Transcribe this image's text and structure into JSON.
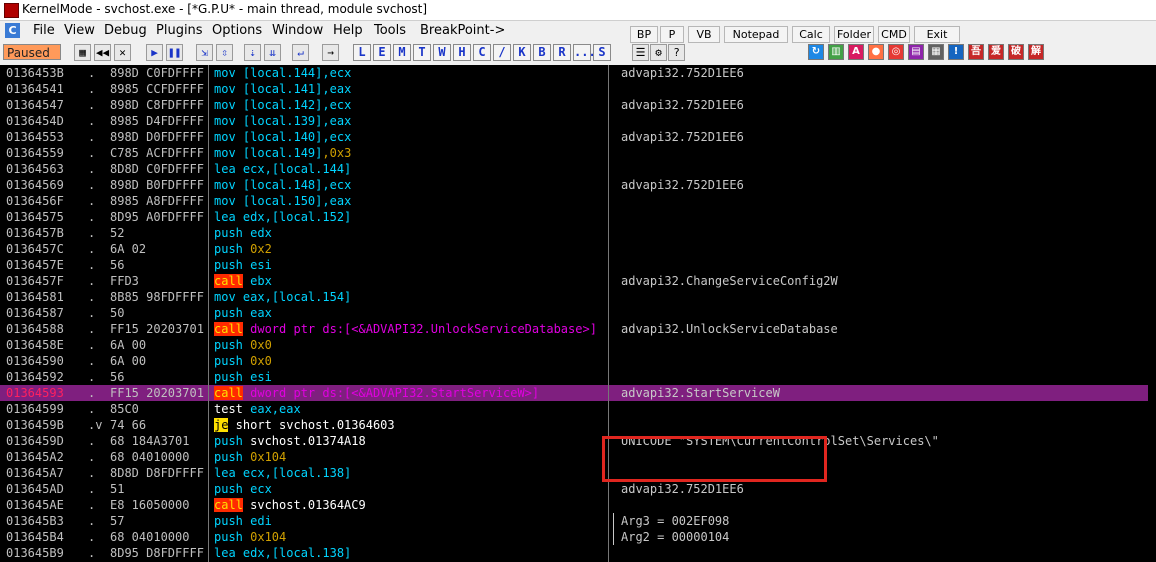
{
  "window": {
    "title": "KernelMode - svchost.exe - [*G.P.U* - main thread, module svchost]",
    "app_icon": "C"
  },
  "menu": [
    "File",
    "View",
    "Debug",
    "Plugins",
    "Options",
    "Window",
    "Help",
    "Tools",
    "BreakPoint->"
  ],
  "gpu_buttons": [
    "BP",
    "P",
    "VB",
    "Notepad",
    "Calc",
    "Folder",
    "CMD",
    "Exit"
  ],
  "toolbar": {
    "status": "Paused",
    "left_buttons": [
      "open-icon",
      "rewind-icon",
      "close-icon",
      "play-icon",
      "pause-icon",
      "step-into-icon",
      "step-over-icon",
      "trace-into-icon",
      "trace-over-icon",
      "execute-till-return-icon",
      "go-to-icon"
    ],
    "letters": [
      "L",
      "E",
      "M",
      "T",
      "W",
      "H",
      "C",
      "/",
      "K",
      "B",
      "R",
      "...",
      "S"
    ],
    "right_icons": [
      "refresh-icon",
      "plugin-icon",
      "a-icon",
      "record-icon",
      "target-icon",
      "bookmark-icon",
      "grid-icon",
      "help-icon"
    ],
    "cn_icons": [
      "吾",
      "爱",
      "破",
      "解"
    ],
    "aux_icons": [
      "list-icon",
      "settings-icon",
      "help-icon"
    ]
  },
  "rows": [
    {
      "addr": "0136453B",
      "dot": ".",
      "hex": "898D C0FDFFFF",
      "dis": [
        [
          "mov",
          "mn"
        ],
        [
          " [local.144]",
          "op-brk"
        ],
        [
          ",ecx",
          "op-brk"
        ]
      ],
      "comment": "advapi32.752D1EE6"
    },
    {
      "addr": "01364541",
      "dot": ".",
      "hex": "8985 CCFDFFFF",
      "dis": [
        [
          "mov",
          "mn"
        ],
        [
          " [local.141]",
          "op-brk"
        ],
        [
          ",eax",
          "op-brk"
        ]
      ],
      "comment": ""
    },
    {
      "addr": "01364547",
      "dot": ".",
      "hex": "898D C8FDFFFF",
      "dis": [
        [
          "mov",
          "mn"
        ],
        [
          " [local.142]",
          "op-brk"
        ],
        [
          ",ecx",
          "op-brk"
        ]
      ],
      "comment": "advapi32.752D1EE6"
    },
    {
      "addr": "0136454D",
      "dot": ".",
      "hex": "8985 D4FDFFFF",
      "dis": [
        [
          "mov",
          "mn"
        ],
        [
          " [local.139]",
          "op-brk"
        ],
        [
          ",eax",
          "op-brk"
        ]
      ],
      "comment": ""
    },
    {
      "addr": "01364553",
      "dot": ".",
      "hex": "898D D0FDFFFF",
      "dis": [
        [
          "mov",
          "mn"
        ],
        [
          " [local.140]",
          "op-brk"
        ],
        [
          ",ecx",
          "op-brk"
        ]
      ],
      "comment": "advapi32.752D1EE6"
    },
    {
      "addr": "01364559",
      "dot": ".",
      "hex": "C785 ACFDFFFF",
      "dis": [
        [
          "mov",
          "mn"
        ],
        [
          " [local.149]",
          "op-brk"
        ],
        [
          ",0x3",
          "op-const"
        ]
      ],
      "comment": ""
    },
    {
      "addr": "01364563",
      "dot": ".",
      "hex": "8D8D C0FDFFFF",
      "dis": [
        [
          "lea",
          "mn"
        ],
        [
          " ecx,",
          "op-brk"
        ],
        [
          "[local.144]",
          "op-brk"
        ]
      ],
      "comment": ""
    },
    {
      "addr": "01364569",
      "dot": ".",
      "hex": "898D B0FDFFFF",
      "dis": [
        [
          "mov",
          "mn"
        ],
        [
          " [local.148]",
          "op-brk"
        ],
        [
          ",ecx",
          "op-brk"
        ]
      ],
      "comment": "advapi32.752D1EE6"
    },
    {
      "addr": "0136456F",
      "dot": ".",
      "hex": "8985 A8FDFFFF",
      "dis": [
        [
          "mov",
          "mn"
        ],
        [
          " [local.150]",
          "op-brk"
        ],
        [
          ",eax",
          "op-brk"
        ]
      ],
      "comment": ""
    },
    {
      "addr": "01364575",
      "dot": ".",
      "hex": "8D95 A0FDFFFF",
      "dis": [
        [
          "lea",
          "mn"
        ],
        [
          " edx,",
          "op-brk"
        ],
        [
          "[local.152]",
          "op-brk"
        ]
      ],
      "comment": ""
    },
    {
      "addr": "0136457B",
      "dot": ".",
      "hex": "52",
      "dis": [
        [
          "push",
          "mn"
        ],
        [
          " edx",
          "op-brk"
        ]
      ],
      "comment": ""
    },
    {
      "addr": "0136457C",
      "dot": ".",
      "hex": "6A 02",
      "dis": [
        [
          "push",
          "mn"
        ],
        [
          " 0x2",
          "op-const"
        ]
      ],
      "comment": ""
    },
    {
      "addr": "0136457E",
      "dot": ".",
      "hex": "56",
      "dis": [
        [
          "push",
          "mn"
        ],
        [
          " esi",
          "op-brk"
        ]
      ],
      "comment": ""
    },
    {
      "addr": "0136457F",
      "dot": ".",
      "hex": "FFD3",
      "dis": [
        [
          "call",
          "call"
        ],
        [
          " ebx",
          "op-brk"
        ]
      ],
      "comment": "advapi32.ChangeServiceConfig2W"
    },
    {
      "addr": "01364581",
      "dot": ".",
      "hex": "8B85 98FDFFFF",
      "dis": [
        [
          "mov",
          "mn"
        ],
        [
          " eax,",
          "op-brk"
        ],
        [
          "[local.154]",
          "op-brk"
        ]
      ],
      "comment": ""
    },
    {
      "addr": "01364587",
      "dot": ".",
      "hex": "50",
      "dis": [
        [
          "push",
          "mn"
        ],
        [
          " eax",
          "op-brk"
        ]
      ],
      "comment": ""
    },
    {
      "addr": "01364588",
      "dot": ".",
      "hex": "FF15 20203701",
      "dis": [
        [
          "call",
          "call"
        ],
        [
          " dword ptr ds:[<&ADVAPI32.UnlockServiceDatabase>]",
          "op-ds"
        ]
      ],
      "comment": "advapi32.UnlockServiceDatabase"
    },
    {
      "addr": "0136458E",
      "dot": ".",
      "hex": "6A 00",
      "dis": [
        [
          "push",
          "mn"
        ],
        [
          " 0x0",
          "op-const"
        ]
      ],
      "comment": ""
    },
    {
      "addr": "01364590",
      "dot": ".",
      "hex": "6A 00",
      "dis": [
        [
          "push",
          "mn"
        ],
        [
          " 0x0",
          "op-const"
        ]
      ],
      "comment": ""
    },
    {
      "addr": "01364592",
      "dot": ".",
      "hex": "56",
      "dis": [
        [
          "push",
          "mn"
        ],
        [
          " esi",
          "op-brk"
        ]
      ],
      "comment": ""
    },
    {
      "addr": "01364593",
      "dot": ".",
      "hex": "FF15 20203701",
      "dis": [
        [
          "call",
          "call"
        ],
        [
          " dword ptr ds:[<&ADVAPI32.StartServiceW>]",
          "op-ds"
        ]
      ],
      "comment": "advapi32.StartServiceW",
      "selected": true
    },
    {
      "addr": "01364599",
      "dot": ".",
      "hex": "85C0",
      "dis": [
        [
          "test",
          "test"
        ],
        [
          " eax,eax",
          "op-brk"
        ]
      ],
      "comment": ""
    },
    {
      "addr": "0136459B",
      "dot": ".v",
      "hex": "74 66",
      "dis": [
        [
          "je",
          "je"
        ],
        [
          " short svchost.01364603",
          "short"
        ]
      ],
      "comment": ""
    },
    {
      "addr": "0136459D",
      "dot": ".",
      "hex": "68 184A3701",
      "dis": [
        [
          "push",
          "mn"
        ],
        [
          " svchost.01374A18",
          "short"
        ]
      ],
      "comment": "UNICODE \"SYSTEM\\CurrentControlSet\\Services\\\""
    },
    {
      "addr": "013645A2",
      "dot": ".",
      "hex": "68 04010000",
      "dis": [
        [
          "push",
          "mn"
        ],
        [
          " 0x104",
          "op-const"
        ]
      ],
      "comment": ""
    },
    {
      "addr": "013645A7",
      "dot": ".",
      "hex": "8D8D D8FDFFFF",
      "dis": [
        [
          "lea",
          "mn"
        ],
        [
          " ecx,",
          "op-brk"
        ],
        [
          "[local.138]",
          "op-brk"
        ]
      ],
      "comment": ""
    },
    {
      "addr": "013645AD",
      "dot": ".",
      "hex": "51",
      "dis": [
        [
          "push",
          "mn"
        ],
        [
          " ecx",
          "op-brk"
        ]
      ],
      "comment": "advapi32.752D1EE6"
    },
    {
      "addr": "013645AE",
      "dot": ".",
      "hex": "E8 16050000",
      "dis": [
        [
          "call",
          "call"
        ],
        [
          " svchost.01364AC9",
          "short"
        ]
      ],
      "comment": ""
    },
    {
      "addr": "013645B3",
      "dot": ".",
      "hex": "57",
      "dis": [
        [
          "push",
          "mn"
        ],
        [
          " edi",
          "op-brk"
        ]
      ],
      "comment": "Arg3 = 002EF098"
    },
    {
      "addr": "013645B4",
      "dot": ".",
      "hex": "68 04010000",
      "dis": [
        [
          "push",
          "mn"
        ],
        [
          " 0x104",
          "op-const"
        ]
      ],
      "comment": "Arg2 = 00000104"
    },
    {
      "addr": "013645B9",
      "dot": ".",
      "hex": "8D95 D8FDFFFF",
      "dis": [
        [
          "lea",
          "mn"
        ],
        [
          " edx,",
          "op-brk"
        ],
        [
          "[local.138]",
          "op-brk"
        ]
      ],
      "comment": ""
    }
  ]
}
